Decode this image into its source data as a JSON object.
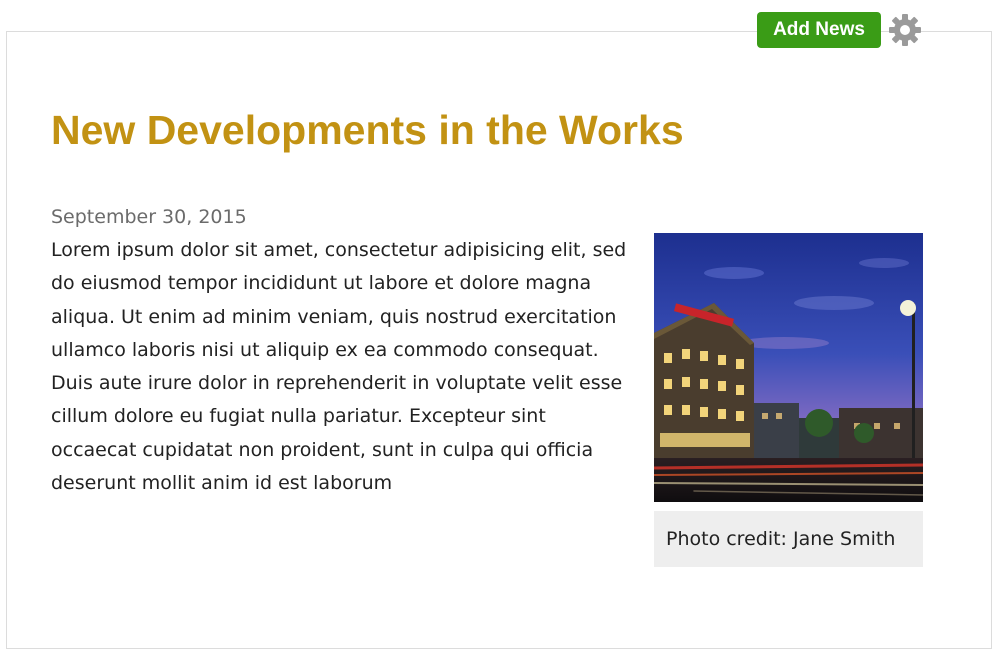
{
  "toolbar": {
    "add_news_label": "Add News",
    "settings_icon": "gear-icon",
    "add_news_color": "#3a9c16"
  },
  "article": {
    "title": "New Developments in the Works",
    "title_color": "#c29213",
    "date": "September 30, 2015",
    "body": "Lorem ipsum dolor sit amet, consectetur adipisicing elit, sed do eiusmod tempor incididunt ut labore et dolore magna aliqua. Ut enim ad minim veniam, quis nostrud exercitation ullamco laboris nisi ut aliquip ex ea commodo consequat. Duis aute irure dolor in reprehenderit in voluptate velit esse cillum dolore eu fugiat nulla pariatur. Excepteur sint occaecat cupidatat non proident, sunt in culpa qui officia deserunt mollit anim id est laborum",
    "photo_caption": "Photo credit: Jane Smith"
  }
}
